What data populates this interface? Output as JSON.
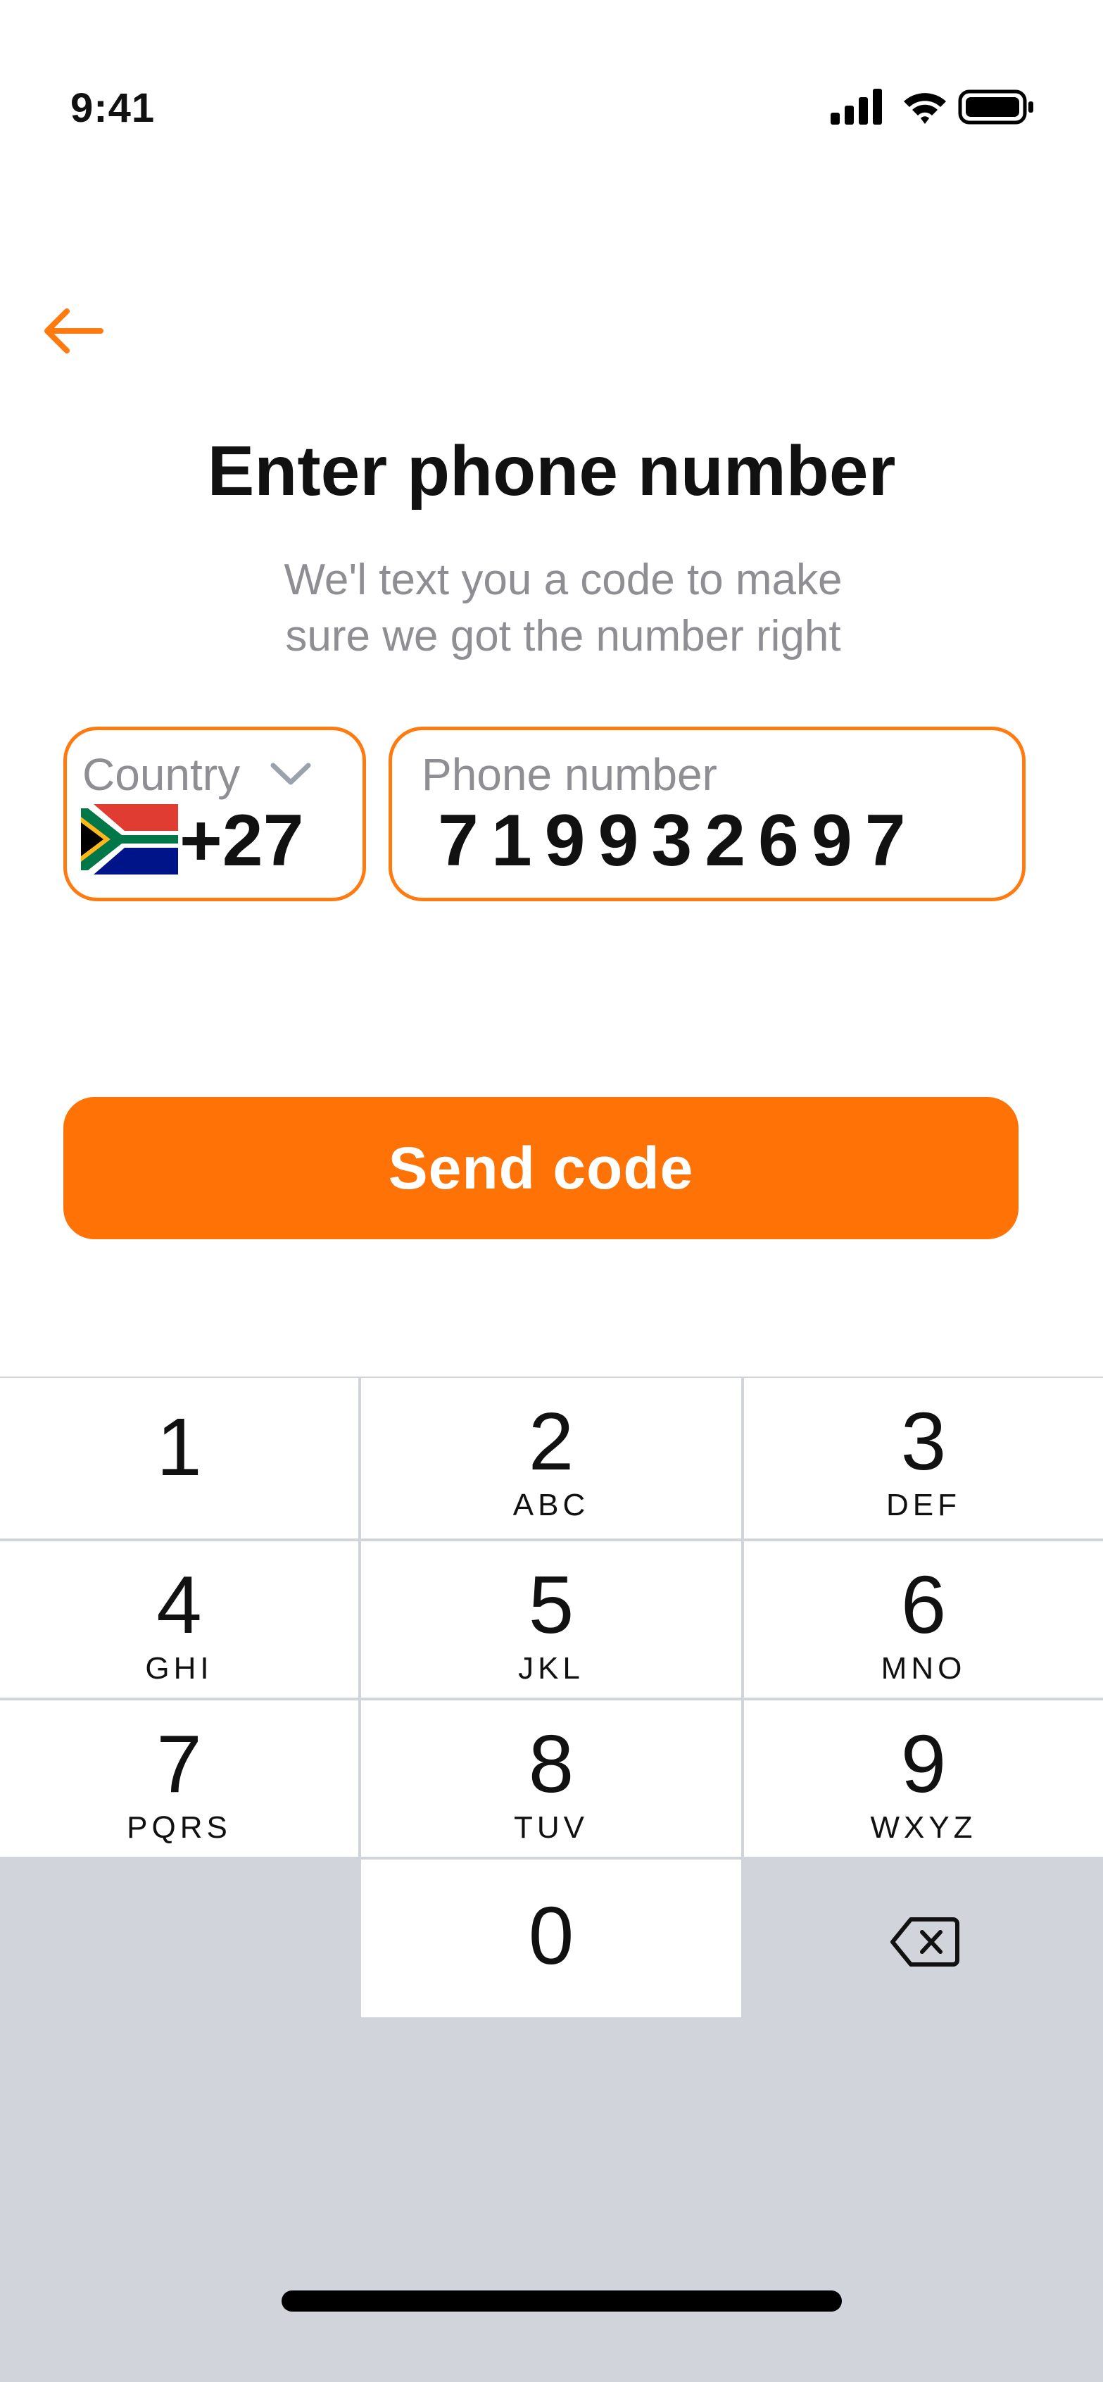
{
  "status_bar": {
    "time": "9:41",
    "icons": [
      "cellular-signal-icon",
      "wifi-icon",
      "battery-icon"
    ]
  },
  "header": {
    "back_icon": "arrow-left-icon",
    "title": "Enter phone number",
    "subtitle_line1": "We'l text you a code to make",
    "subtitle_line2": "sure we got the number right"
  },
  "form": {
    "country": {
      "label": "Country",
      "flag": "south-africa-flag-icon",
      "dial_code": "+27",
      "dropdown_icon": "chevron-down-icon"
    },
    "phone": {
      "label": "Phone number",
      "value": "719932697"
    },
    "submit_label": "Send code"
  },
  "keypad": {
    "keys": [
      {
        "digit": "1",
        "letters": ""
      },
      {
        "digit": "2",
        "letters": "ABC"
      },
      {
        "digit": "3",
        "letters": "DEF"
      },
      {
        "digit": "4",
        "letters": "GHI"
      },
      {
        "digit": "5",
        "letters": "JKL"
      },
      {
        "digit": "6",
        "letters": "MNO"
      },
      {
        "digit": "7",
        "letters": "PQRS"
      },
      {
        "digit": "8",
        "letters": "TUV"
      },
      {
        "digit": "9",
        "letters": "WXYZ"
      },
      {
        "digit": "0",
        "letters": ""
      }
    ],
    "delete_icon": "backspace-icon"
  },
  "colors": {
    "accent": "#ff7306",
    "field_border": "#ff7a0f",
    "muted_text": "#8e8e93",
    "keypad_background": "#d1d4da"
  }
}
